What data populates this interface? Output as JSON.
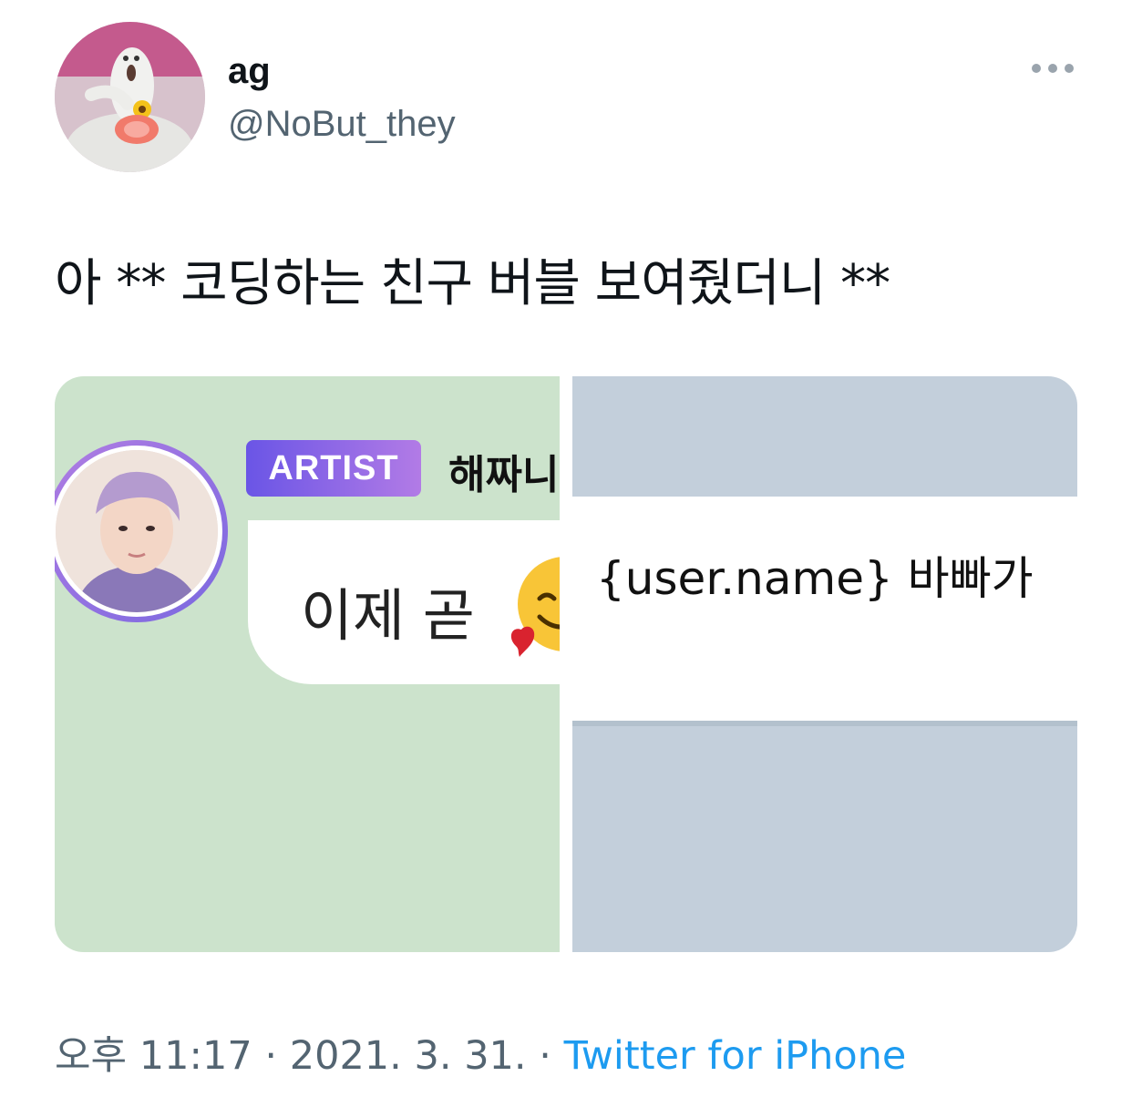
{
  "author": {
    "display_name": "ag",
    "handle": "@NoBut_they",
    "avatar_icon": "avatar-figure-with-flower"
  },
  "menu": {
    "icon": "more-dots-icon"
  },
  "tweet": {
    "text": "아 ** 코딩하는 친구 버블 보여줬더니 **"
  },
  "media": {
    "left": {
      "badge": "ARTIST",
      "artist_name": "해짜니",
      "message": "이제 곧",
      "emoji": "smiling-face-with-hearts",
      "bg_color": "#cce3cc"
    },
    "right": {
      "message": "{user.name} 바빠가",
      "bg_color": "#c3cfdb"
    }
  },
  "meta": {
    "time": "오후 11:17",
    "separator1": " · ",
    "date": "2021. 3. 31.",
    "separator2": " · ",
    "source": "Twitter for iPhone",
    "source_color": "#1d9bf0"
  }
}
